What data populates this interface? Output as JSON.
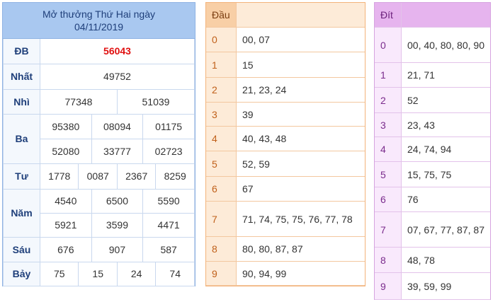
{
  "results": {
    "title_line1": "Mở thưởng Thứ Hai ngày",
    "title_line2": "04/11/2019",
    "labels": {
      "db": "ĐB",
      "nhat": "Nhất",
      "nhi": "Nhì",
      "ba": "Ba",
      "tu": "Tư",
      "nam": "Năm",
      "sau": "Sáu",
      "bay": "Bảy"
    },
    "db": "56043",
    "nhat": "49752",
    "nhi": [
      "77348",
      "51039"
    ],
    "ba": [
      "95380",
      "08094",
      "01175",
      "52080",
      "33777",
      "02723"
    ],
    "tu": [
      "1778",
      "0087",
      "2367",
      "8259"
    ],
    "nam": [
      "4540",
      "6500",
      "5590",
      "5921",
      "3599",
      "4471"
    ],
    "sau": [
      "676",
      "907",
      "587"
    ],
    "bay": [
      "75",
      "15",
      "24",
      "74"
    ]
  },
  "dau": {
    "header": "Đầu",
    "rows": [
      {
        "k": "0",
        "v": "00, 07"
      },
      {
        "k": "1",
        "v": "15"
      },
      {
        "k": "2",
        "v": "21, 23, 24"
      },
      {
        "k": "3",
        "v": "39"
      },
      {
        "k": "4",
        "v": "40, 43, 48"
      },
      {
        "k": "5",
        "v": "52, 59"
      },
      {
        "k": "6",
        "v": "67"
      },
      {
        "k": "7",
        "v": "71, 74, 75, 75, 76, 77, 78"
      },
      {
        "k": "8",
        "v": "80, 80, 87, 87"
      },
      {
        "k": "9",
        "v": "90, 94, 99"
      }
    ]
  },
  "dit": {
    "header": "Đít",
    "rows": [
      {
        "k": "0",
        "v": "00, 40, 80, 80, 90"
      },
      {
        "k": "1",
        "v": "21, 71"
      },
      {
        "k": "2",
        "v": "52"
      },
      {
        "k": "3",
        "v": "23, 43"
      },
      {
        "k": "4",
        "v": "24, 74, 94"
      },
      {
        "k": "5",
        "v": "15, 75, 75"
      },
      {
        "k": "6",
        "v": "76"
      },
      {
        "k": "7",
        "v": "07, 67, 77, 87, 87"
      },
      {
        "k": "8",
        "v": "48, 78"
      },
      {
        "k": "9",
        "v": "39, 59, 99"
      }
    ]
  },
  "colors": {
    "results_header": "#a9c8f0",
    "special": "#e01010",
    "dau_bg": "#fdebd8",
    "dit_bg": "#f9e9fc"
  }
}
